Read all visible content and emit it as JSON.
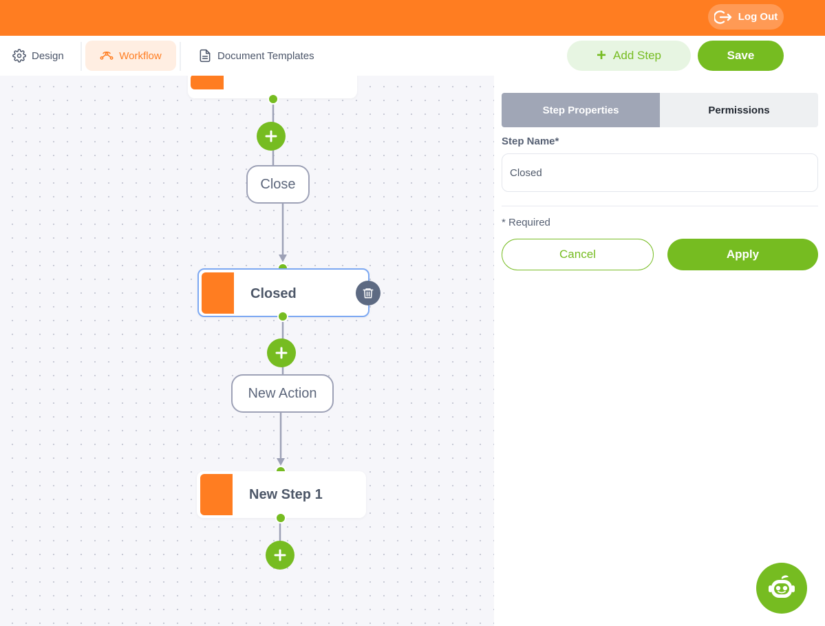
{
  "header": {
    "logout_label": "Log Out"
  },
  "tabs": {
    "design_label": "Design",
    "workflow_label": "Workflow",
    "documents_label": "Document Templates",
    "active": "Workflow"
  },
  "toolbar": {
    "add_step_label": "Add Step",
    "save_label": "Save"
  },
  "workflow": {
    "actions": [
      {
        "label": "Close"
      },
      {
        "label": "New Action"
      }
    ],
    "steps": [
      {
        "label": ""
      },
      {
        "label": "Closed",
        "selected": true
      },
      {
        "label": "New Step 1"
      }
    ]
  },
  "panel": {
    "tabs": [
      {
        "label": "Step Properties",
        "active": true
      },
      {
        "label": "Permissions",
        "active": false
      }
    ],
    "step_name_label": "Step Name*",
    "step_name_value": "Closed",
    "required_note": "* Required",
    "cancel_label": "Cancel",
    "apply_label": "Apply"
  },
  "colors": {
    "brand_orange": "#ff7d21",
    "accent_green": "#76bc21",
    "selected_border": "#7ca8f2"
  },
  "icons": {
    "logout": "logout-icon",
    "design": "gear-icon",
    "workflow": "workflow-icon",
    "documents": "document-icon",
    "add": "plus-icon",
    "delete": "trash-icon",
    "assistant": "robot-icon"
  }
}
